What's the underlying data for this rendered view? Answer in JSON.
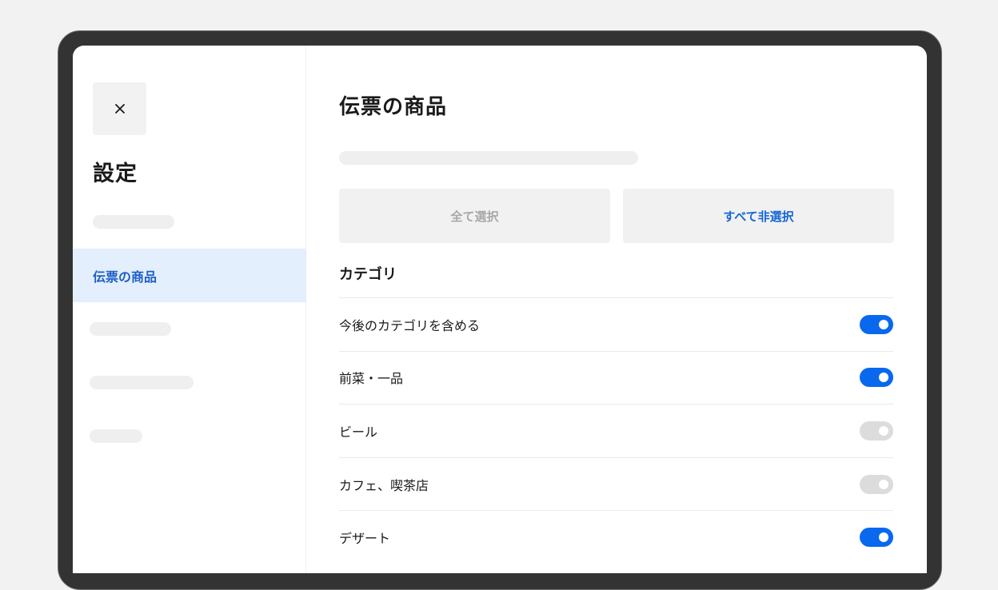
{
  "sidebar": {
    "close_icon": "close-icon",
    "title": "設定",
    "active_item": "伝票の商品"
  },
  "main": {
    "title": "伝票の商品",
    "select_all_label": "全て選択",
    "deselect_all_label": "すべて非選択",
    "section_title": "カテゴリ",
    "categories": [
      {
        "label": "今後のカテゴリを含める",
        "enabled": true
      },
      {
        "label": "前菜・一品",
        "enabled": true
      },
      {
        "label": "ビール",
        "enabled": false
      },
      {
        "label": "カフェ、喫茶店",
        "enabled": false
      },
      {
        "label": "デザート",
        "enabled": true
      }
    ]
  },
  "colors": {
    "accent": "#0a68ee",
    "active_bg": "#e3effd",
    "active_text": "#1c5fc6",
    "toggle_off": "#dcdcdc"
  }
}
